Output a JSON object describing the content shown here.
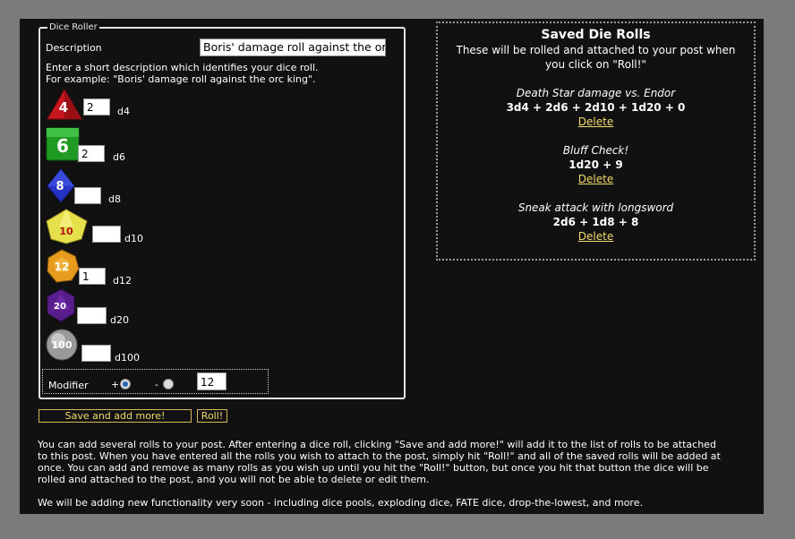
{
  "roller": {
    "legend": "Dice Roller",
    "description_label": "Description",
    "description_value": "Boris' damage roll against the orc",
    "hint_line1": "Enter a short description which identifies your dice roll.",
    "hint_line2": "For example: \"Boris' damage roll against the orc king\".",
    "dice": [
      {
        "label": "d4",
        "value": "2",
        "icon_text": "4",
        "color": "#c8181f"
      },
      {
        "label": "d6",
        "value": "2",
        "icon_text": "6",
        "color": "#1f9a23"
      },
      {
        "label": "d8",
        "value": "",
        "icon_text": "8",
        "color": "#2433c4"
      },
      {
        "label": "d10",
        "value": "",
        "icon_text": "10",
        "color": "#e6e04a"
      },
      {
        "label": "d12",
        "value": "1",
        "icon_text": "12",
        "color": "#e69a1e"
      },
      {
        "label": "d20",
        "value": "",
        "icon_text": "20",
        "color": "#5a1e8c"
      },
      {
        "label": "d100",
        "value": "",
        "icon_text": "100",
        "color": "#9a9a9a"
      }
    ],
    "modifier_label": "Modifier",
    "plus": "+",
    "minus": "-",
    "modifier_value": "12"
  },
  "buttons": {
    "save_label": "Save and add more!",
    "roll_label": "Roll!"
  },
  "saved": {
    "title": "Saved Die Rolls",
    "subtitle_line1": "These will be rolled and attached to your post when",
    "subtitle_line2": "you click on \"Roll!\"",
    "rolls": [
      {
        "name": "Death Star damage vs. Endor",
        "formula": "3d4 + 2d6 + 2d10 + 1d20 + 0",
        "delete": "Delete"
      },
      {
        "name": "Bluff Check!",
        "formula": "1d20 + 9",
        "delete": "Delete"
      },
      {
        "name": "Sneak attack with longsword",
        "formula": "2d6 + 1d8 + 8",
        "delete": "Delete"
      }
    ]
  },
  "info": {
    "lines": [
      "You can add several rolls to your post. After entering a dice roll, clicking \"Save and add more!\" will add it to the list of rolls to be attached",
      "to this post. When you have entered all the rolls you wish to attach to the post, simply hit \"Roll!\" and all of the saved rolls will be added at",
      "once. You can add and remove as many rolls as you wish up until you hit the \"Roll!\" button, but once you hit that button the dice will be",
      "rolled and attached to the post, and you will not be able to delete or edit them."
    ],
    "note": "We will be adding new functionality very soon - including dice pools, exploding dice, FATE dice, drop-the-lowest, and more."
  }
}
